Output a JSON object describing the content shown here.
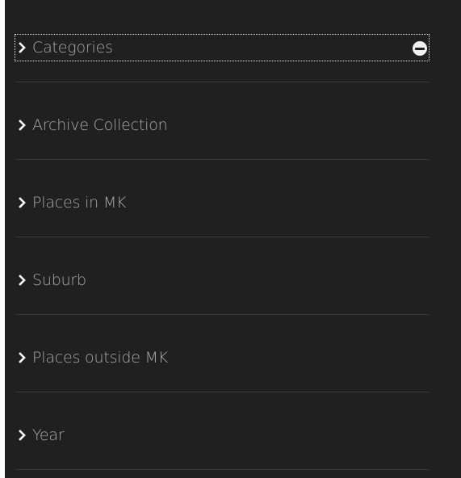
{
  "colors": {
    "panel_background": "#202020",
    "label_text": "#a9a9a9",
    "divider": "#3c3c3c",
    "chevron": "#ffffff",
    "collapse_icon": "#f2f2f2"
  },
  "filter_panel": {
    "items": [
      {
        "label": "Categories",
        "icon": "chevron-right-icon",
        "expanded": true,
        "action_icon": "minus-circle-icon"
      },
      {
        "label": "Archive Collection",
        "icon": "chevron-right-icon"
      },
      {
        "label": "Places in MK",
        "icon": "chevron-right-icon"
      },
      {
        "label": "Suburb",
        "icon": "chevron-right-icon"
      },
      {
        "label": "Places outside MK",
        "icon": "chevron-right-icon"
      },
      {
        "label": "Year",
        "icon": "chevron-right-icon"
      }
    ]
  }
}
